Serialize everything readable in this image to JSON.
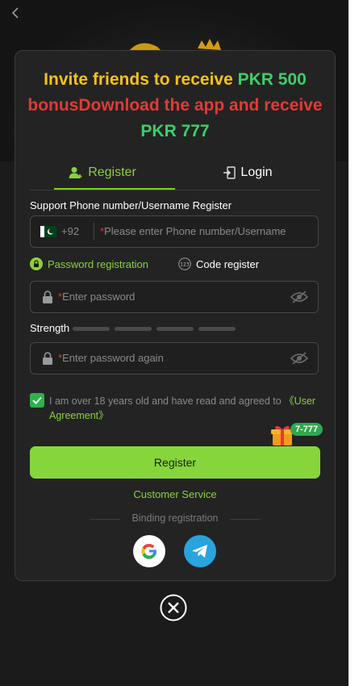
{
  "promo": {
    "line1_part1": "Invite friends to receive ",
    "line1_part2": "PKR 500",
    "line2": "bonusDownload the app and receive",
    "line3": "PKR 777"
  },
  "tabs": {
    "register": "Register",
    "login": "Login"
  },
  "form": {
    "phone_label": "Support Phone number/Username Register",
    "country_code": "+92",
    "phone_placeholder": "Please enter Phone number/Username",
    "required_mark": "*",
    "mode_password": "Password registration",
    "mode_code": "Code register",
    "password_placeholder": "Enter password",
    "strength_label": "Strength",
    "password_again_placeholder": "Enter password again",
    "agree_text": "I am over 18 years old and have read and agreed to ",
    "agree_link": "《User Agreement》",
    "gift_badge": "7-777",
    "register_button": "Register",
    "customer_service": "Customer Service",
    "binding_label": "Binding registration"
  },
  "icons": {
    "back": "chevron-left-icon",
    "add_user": "add-user-icon",
    "login": "login-door-icon",
    "flag": "pakistan-flag-icon",
    "lock": "lock-icon",
    "eye": "eye-off-icon",
    "checkbox": "check-icon",
    "gift": "gift-icon",
    "google": "google-icon",
    "telegram": "telegram-icon",
    "close": "close-circle-icon"
  },
  "colors": {
    "accent_green": "#86d63b",
    "promo_yellow": "#f5c21b",
    "promo_green": "#3ccf6a",
    "promo_red": "#e53935",
    "background": "#1b1b1b",
    "card": "#232323"
  }
}
